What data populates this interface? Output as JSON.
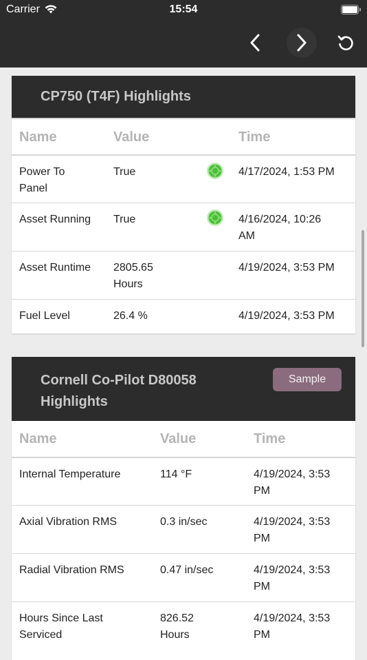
{
  "status_bar": {
    "carrier": "Carrier",
    "time": "15:54"
  },
  "nav": {
    "back_icon": "chevron-left-icon",
    "forward_icon": "chevron-right-icon",
    "refresh_icon": "refresh-icon"
  },
  "colors": {
    "header_bg": "#2c2c2c",
    "indicator_green": "#4ec23a",
    "sample_button": "#8a6c7e"
  },
  "card1": {
    "title": "CP750 (T4F) Highlights",
    "columns": [
      "Name",
      "Value",
      "Time"
    ],
    "rows": [
      {
        "name_l1": "Power To",
        "name_l2": "Panel",
        "value_l1": "True",
        "value_l2": "",
        "time_l1": "4/17/2024, 1:53 PM",
        "time_l2": "",
        "indicator": "green-status-icon"
      },
      {
        "name_l1": "Asset Running",
        "name_l2": "",
        "value_l1": "True",
        "value_l2": "",
        "time_l1": "4/16/2024, 10:26",
        "time_l2": "AM",
        "indicator": "green-status-icon"
      },
      {
        "name_l1": "Asset Runtime",
        "name_l2": "",
        "value_l1": "2805.65",
        "value_l2": "Hours",
        "time_l1": "4/19/2024, 3:53 PM",
        "time_l2": ""
      },
      {
        "name_l1": "Fuel Level",
        "name_l2": "",
        "value_l1": "26.4 %",
        "value_l2": "",
        "time_l1": "4/19/2024, 3:53 PM",
        "time_l2": ""
      }
    ]
  },
  "card2": {
    "title_l1": "Cornell Co-Pilot D80058",
    "title_l2": "Highlights",
    "sample_label": "Sample",
    "columns": [
      "Name",
      "Value",
      "Time"
    ],
    "rows": [
      {
        "name_l1": "Internal Temperature",
        "name_l2": "",
        "value_l1": "114 °F",
        "value_l2": "",
        "time_l1": "4/19/2024, 3:53",
        "time_l2": "PM"
      },
      {
        "name_l1": "Axial Vibration RMS",
        "name_l2": "",
        "value_l1": "0.3 in/sec",
        "value_l2": "",
        "time_l1": "4/19/2024, 3:53",
        "time_l2": "PM"
      },
      {
        "name_l1": "Radial Vibration RMS",
        "name_l2": "",
        "value_l1": "0.47 in/sec",
        "value_l2": "",
        "time_l1": "4/19/2024, 3:53",
        "time_l2": "PM"
      },
      {
        "name_l1": "Hours Since Last",
        "name_l2": "Serviced",
        "value_l1": "826.52",
        "value_l2": "Hours",
        "time_l1": "4/19/2024, 3:53",
        "time_l2": "PM"
      }
    ]
  }
}
